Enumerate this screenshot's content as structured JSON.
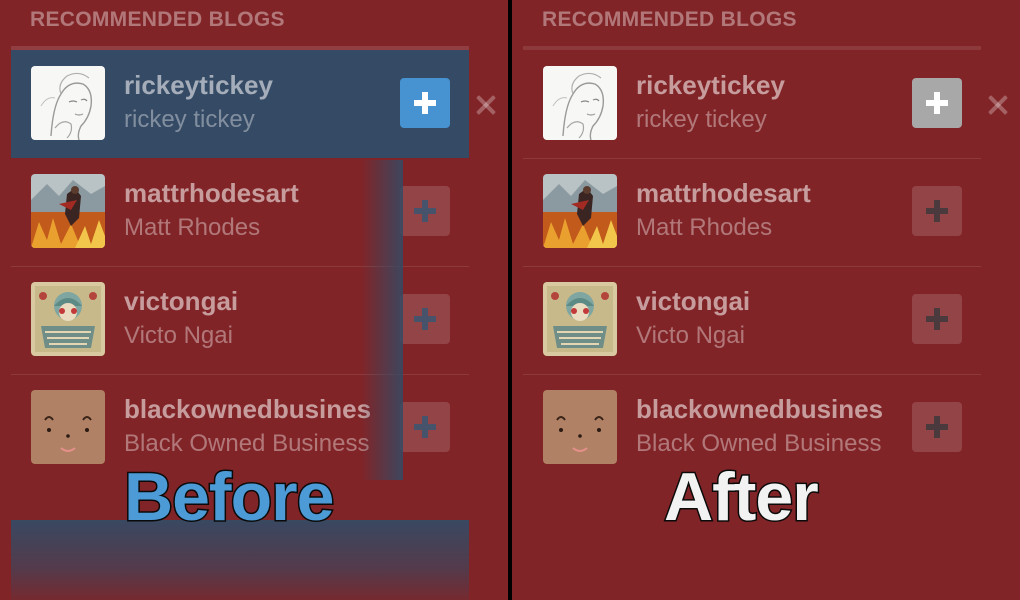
{
  "panels": {
    "before": {
      "heading": "RECOMMENDED BLOGS",
      "caption": "Before",
      "blogs": [
        {
          "username": "rickeytickey",
          "display_name": "rickey tickey",
          "avatar": "sketch-portrait",
          "state": "highlighted"
        },
        {
          "username": "mattrhodesart",
          "display_name": "Matt Rhodes",
          "avatar": "fire-warrior-art",
          "state": "default"
        },
        {
          "username": "victongai",
          "display_name": "Victo Ngai",
          "avatar": "ornate-illustration",
          "state": "default"
        },
        {
          "username": "blackownedbusines",
          "display_name": "Black Owned Business",
          "avatar": "smiley-face",
          "state": "default"
        }
      ]
    },
    "after": {
      "heading": "RECOMMENDED BLOGS",
      "caption": "After",
      "blogs": [
        {
          "username": "rickeytickey",
          "display_name": "rickey tickey",
          "avatar": "sketch-portrait",
          "state": "hover"
        },
        {
          "username": "mattrhodesart",
          "display_name": "Matt Rhodes",
          "avatar": "fire-warrior-art",
          "state": "default"
        },
        {
          "username": "victongai",
          "display_name": "Victo Ngai",
          "avatar": "ornate-illustration",
          "state": "default"
        },
        {
          "username": "blackownedbusines",
          "display_name": "Black Owned Business",
          "avatar": "smiley-face",
          "state": "default"
        }
      ]
    }
  },
  "icons": {
    "follow": "plus-icon",
    "dismiss": "close-icon"
  },
  "colors": {
    "panel_background": "#812427",
    "highlight_row": "#354a64",
    "follow_active_blue": "#4793d1",
    "follow_active_gray": "#a8a8a8",
    "caption_before": "#4c9ad6",
    "caption_after": "#f2f2f2"
  }
}
